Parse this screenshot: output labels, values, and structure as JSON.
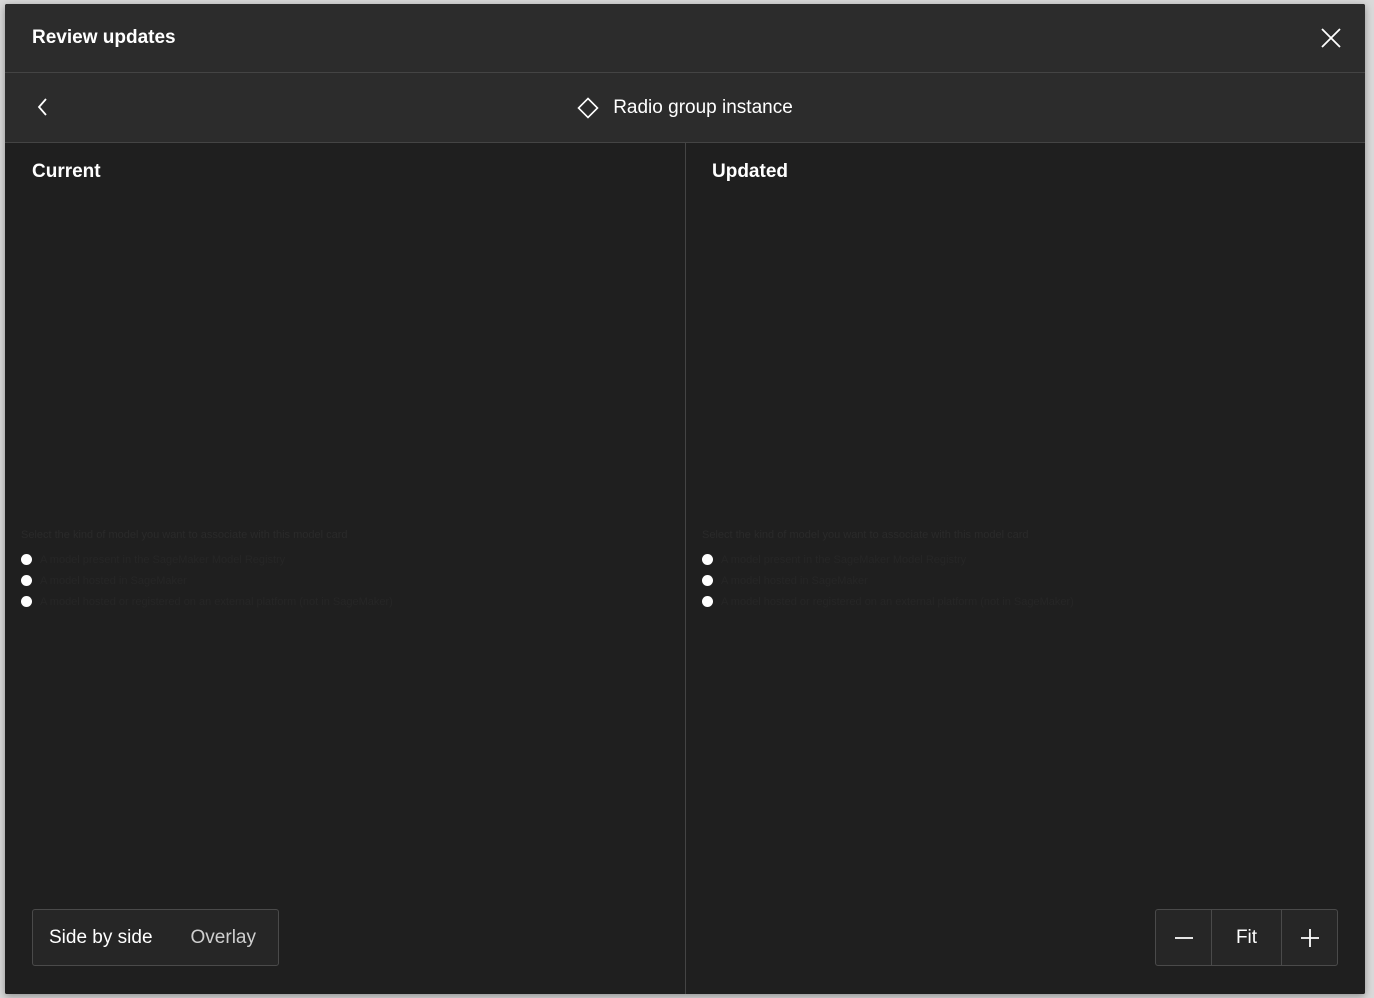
{
  "dialog": {
    "title": "Review updates",
    "close_icon": "close-icon"
  },
  "subheader": {
    "back_icon": "chevron-left-icon",
    "instance_icon": "component-diamond-icon",
    "instance_name": "Radio group instance"
  },
  "panels": {
    "current": {
      "label": "Current",
      "preview": {
        "question": "Select the kind of model you want to associate with this model card",
        "options": [
          "A model present in the SageMaker Model Registry",
          "A model hosted in SageMaker",
          "A model hosted or registered on an external platform (not in SageMaker)"
        ]
      }
    },
    "updated": {
      "label": "Updated",
      "preview": {
        "question": "Select the kind of model you want to associate with this model card",
        "options": [
          "A model present in the SageMaker Model Registry",
          "A model hosted in SageMaker",
          "A model hosted or registered on an external platform (not in SageMaker)"
        ]
      }
    }
  },
  "view_toggle": {
    "side_by_side": "Side by side",
    "overlay": "Overlay",
    "selected": "Side by side"
  },
  "zoom": {
    "minus_icon": "minus-icon",
    "fit": "Fit",
    "plus_icon": "plus-icon"
  }
}
